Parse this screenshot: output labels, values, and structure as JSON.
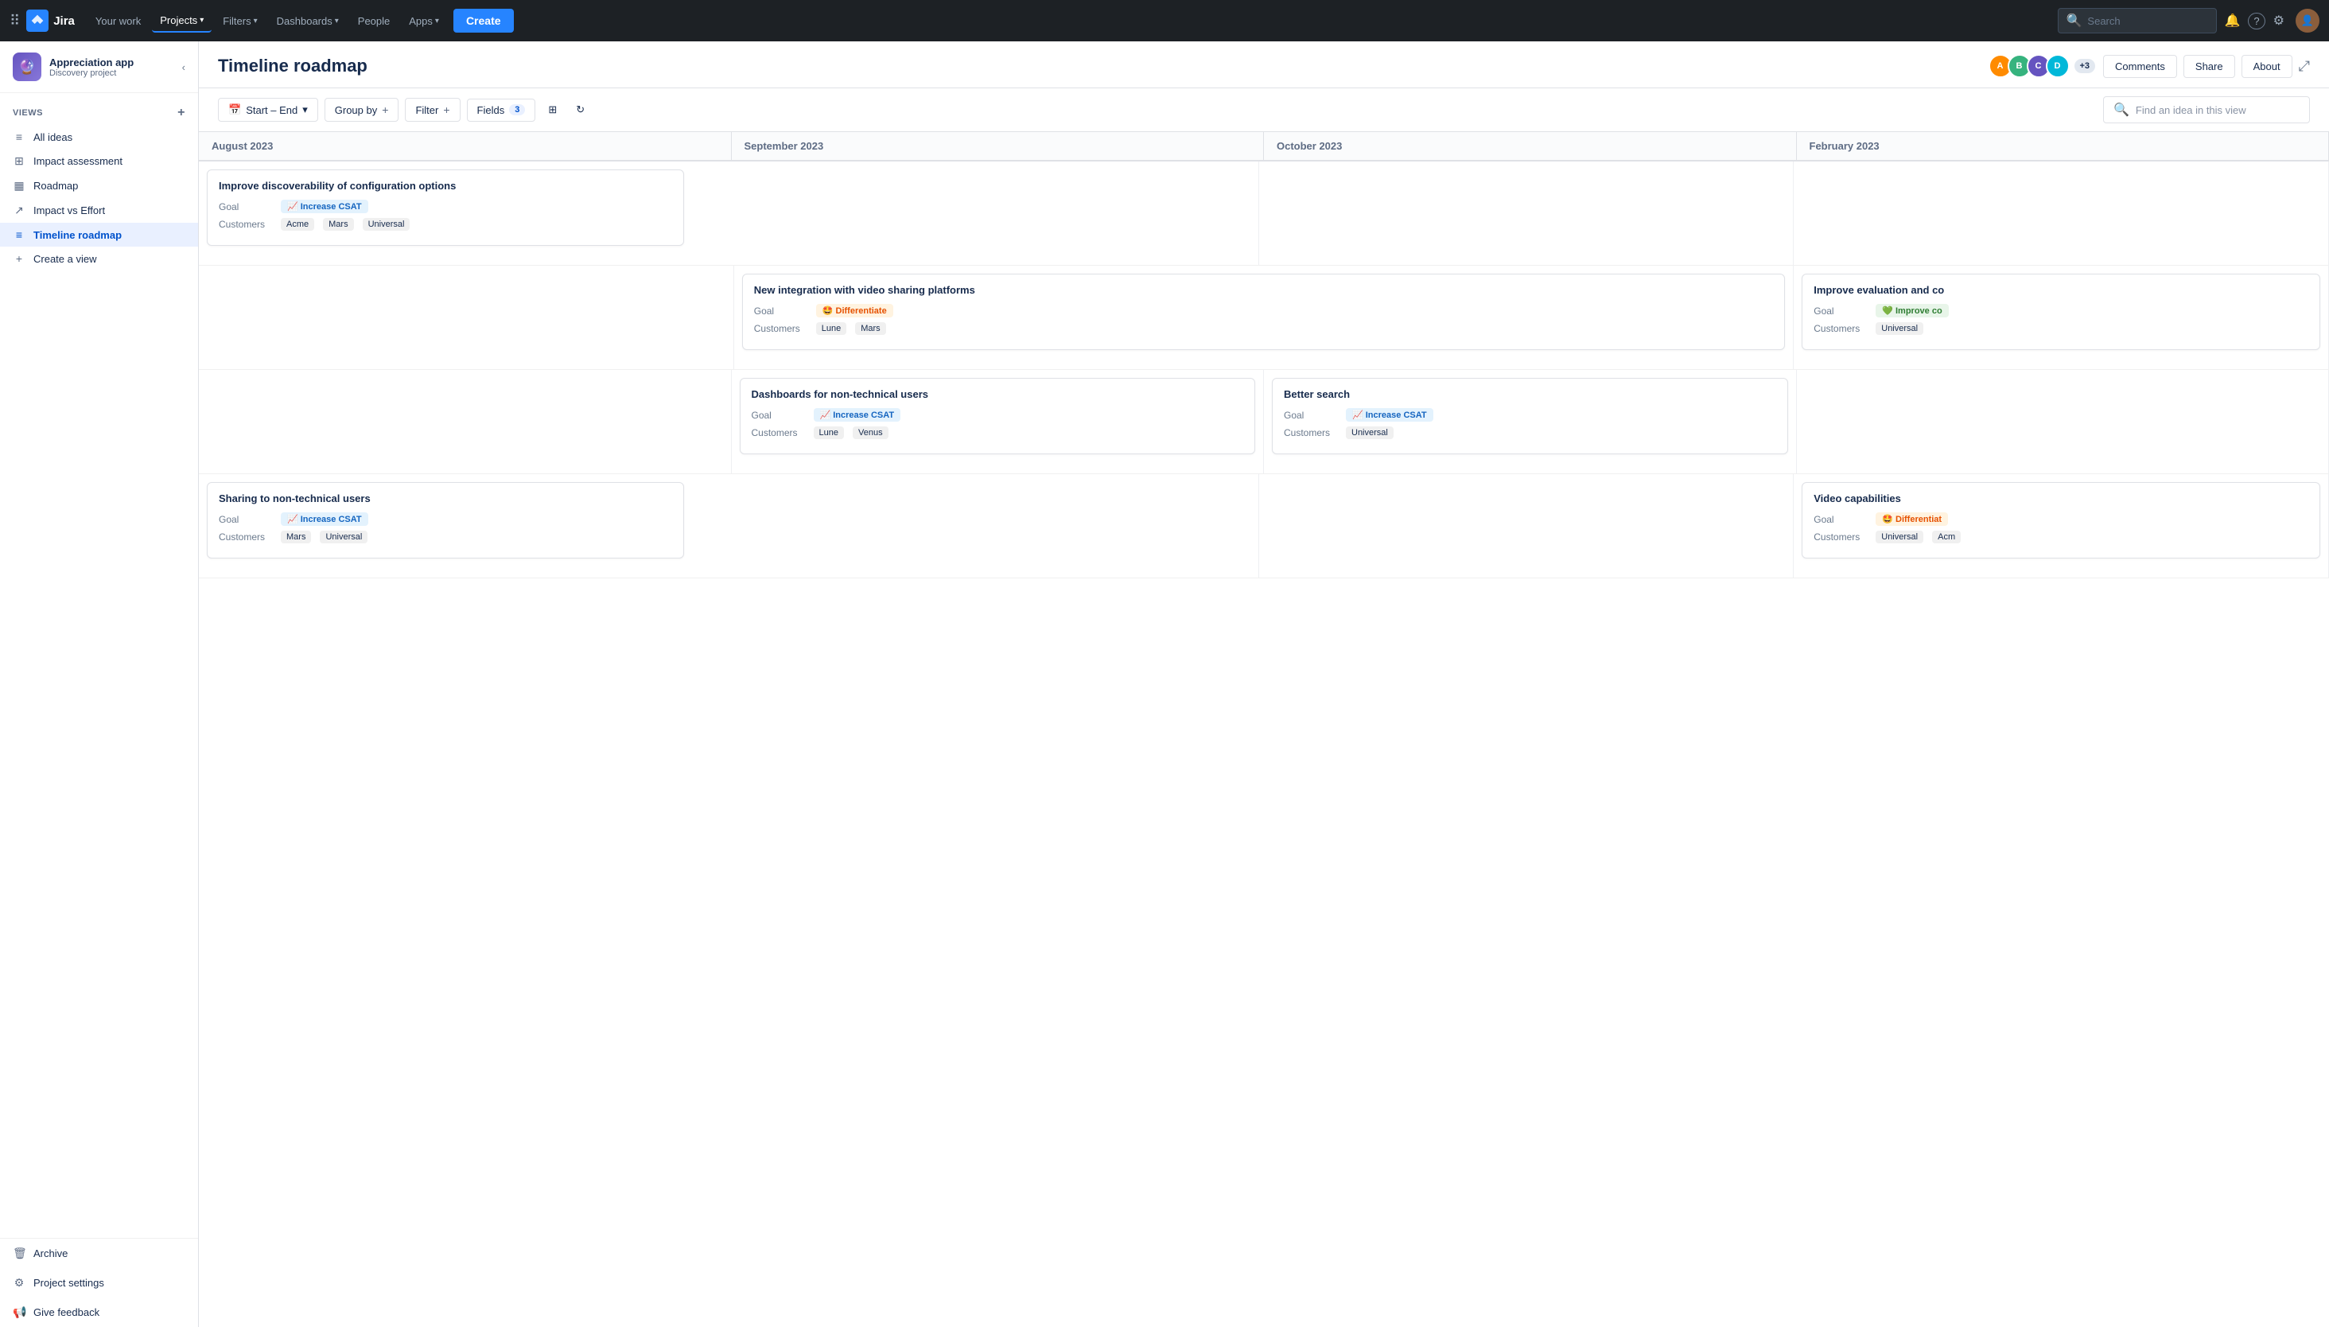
{
  "topnav": {
    "logo_text": "Jira",
    "your_work": "Your work",
    "projects_label": "Projects",
    "filters_label": "Filters",
    "dashboards_label": "Dashboards",
    "people_label": "People",
    "apps_label": "Apps",
    "create_label": "Create",
    "search_placeholder": "Search",
    "bell_icon": "🔔",
    "help_icon": "?",
    "settings_icon": "⚙"
  },
  "sidebar": {
    "project_name": "Appreciation app",
    "project_sub": "Discovery project",
    "views_label": "VIEWS",
    "items": [
      {
        "icon": "≡",
        "label": "All ideas"
      },
      {
        "icon": "⊞",
        "label": "Impact assessment"
      },
      {
        "icon": "▦",
        "label": "Roadmap"
      },
      {
        "icon": "↗",
        "label": "Impact vs Effort"
      },
      {
        "icon": "≡",
        "label": "Timeline roadmap",
        "active": true
      },
      {
        "icon": "+",
        "label": "Create a view"
      }
    ],
    "archive_label": "Archive",
    "project_settings_label": "Project settings",
    "give_feedback_label": "Give feedback"
  },
  "page": {
    "title": "Timeline roadmap",
    "avatars": [
      {
        "color": "#ff8b00",
        "initial": "A"
      },
      {
        "color": "#36b37e",
        "initial": "B"
      },
      {
        "color": "#6554c0",
        "initial": "C"
      },
      {
        "color": "#00b8d9",
        "initial": "D"
      }
    ],
    "avatar_extra": "+3",
    "comments_btn": "Comments",
    "share_btn": "Share",
    "about_btn": "About"
  },
  "toolbar": {
    "start_end_label": "Start – End",
    "group_by_label": "Group by",
    "filter_label": "Filter",
    "fields_label": "Fields",
    "fields_count": "3",
    "search_placeholder": "Find an idea in this view"
  },
  "timeline": {
    "columns": [
      "August 2023",
      "September 2023",
      "October 2023",
      "February 2023"
    ],
    "rows": [
      {
        "cards": [
          {
            "col_start": 0,
            "col_span": 2,
            "title": "Improve discoverability of configuration options",
            "goal_label": "Goal",
            "goal_text": "Increase CSAT",
            "goal_class": "goal-increase-csat",
            "goal_emoji": "📈",
            "customers_label": "Customers",
            "customers": [
              "Acme",
              "Mars",
              "Universal"
            ]
          }
        ]
      },
      {
        "cards": [
          {
            "col_start": 1,
            "col_span": 2,
            "title": "New integration with video sharing platforms",
            "goal_label": "Goal",
            "goal_text": "Differentiate",
            "goal_class": "goal-differentiate",
            "goal_emoji": "🤩",
            "customers_label": "Customers",
            "customers": [
              "Lune",
              "Mars"
            ]
          },
          {
            "col_start": 3,
            "col_span": 1,
            "title": "Improve evaluation and co",
            "goal_label": "Goal",
            "goal_text": "Improve co",
            "goal_class": "goal-improve-co",
            "goal_emoji": "💚",
            "customers_label": "Customers",
            "customers": [
              "Universal"
            ],
            "partial": true
          }
        ]
      },
      {
        "cards": [
          {
            "col_start": 1,
            "col_span": 1,
            "title": "Dashboards for non-technical users",
            "goal_label": "Goal",
            "goal_text": "Increase CSAT",
            "goal_class": "goal-increase-csat",
            "goal_emoji": "📈",
            "customers_label": "Customers",
            "customers": [
              "Lune",
              "Venus"
            ]
          },
          {
            "col_start": 2,
            "col_span": 1,
            "title": "Better search",
            "goal_label": "Goal",
            "goal_text": "Increase CSAT",
            "goal_class": "goal-increase-csat",
            "goal_emoji": "📈",
            "customers_label": "Customers",
            "customers": [
              "Universal"
            ]
          }
        ]
      },
      {
        "cards": [
          {
            "col_start": 0,
            "col_span": 2,
            "title": "Sharing to non-technical users",
            "goal_label": "Goal",
            "goal_text": "Increase CSAT",
            "goal_class": "goal-increase-csat",
            "goal_emoji": "📈",
            "customers_label": "Customers",
            "customers": [
              "Mars",
              "Universal"
            ]
          },
          {
            "col_start": 3,
            "col_span": 1,
            "title": "Video capabilities",
            "goal_label": "Goal",
            "goal_text": "Differentiat",
            "goal_class": "goal-differentiate",
            "goal_emoji": "🤩",
            "customers_label": "Customers",
            "customers": [
              "Universal",
              "Acm"
            ],
            "partial": true
          }
        ]
      }
    ]
  }
}
